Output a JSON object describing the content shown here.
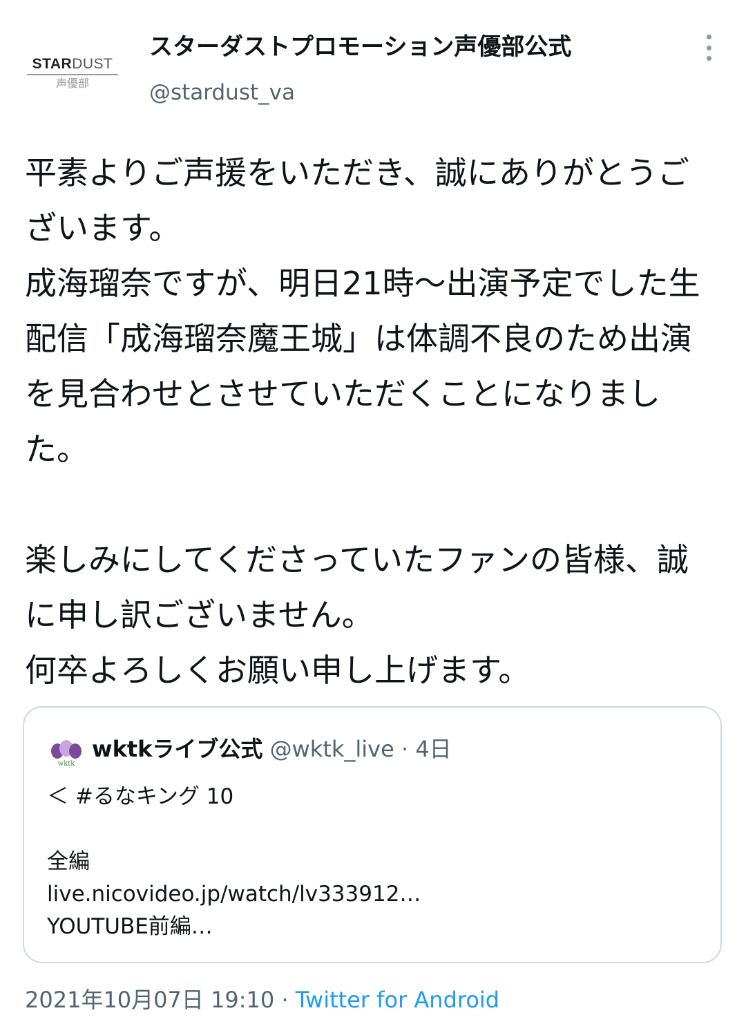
{
  "author": {
    "display_name": "スターダストプロモーション声優部公式",
    "handle": "@stardust_va",
    "avatar": {
      "logo_bold": "STAR",
      "logo_light": "DUST",
      "logo_sub": "声優部"
    }
  },
  "tweet": {
    "paragraphs": [
      "平素よりご声援をいただき、誠にありがとうございます。\n成海瑠奈ですが、明日21時〜出演予定でした生配信「成海瑠奈魔王城」は体調不良のため出演を見合わせとさせていただくことになりました。",
      "楽しみにしてくださっていたファンの皆様、誠に申し訳ございません。\n何卒よろしくお願い申し上げます。"
    ]
  },
  "quoted_tweet": {
    "display_name": "wktkライブ公式",
    "handle": "@wktk_live",
    "separator": "·",
    "time": "4日",
    "lines": [
      "＜ #るなキング 10",
      "",
      "全編",
      "live.nicovideo.jp/watch/lv333912…",
      "YOUTUBE前編…"
    ]
  },
  "footer": {
    "date": "2021年10月07日 19:10",
    "separator": "·",
    "source": "Twitter for Android"
  },
  "icons": {
    "more": "more-vertical-icon",
    "quote_avatar": "wktk-logo-icon"
  },
  "colors": {
    "text": "#0f1419",
    "secondary": "#536471",
    "link": "#1d9bf0",
    "border": "#cfd9de"
  }
}
